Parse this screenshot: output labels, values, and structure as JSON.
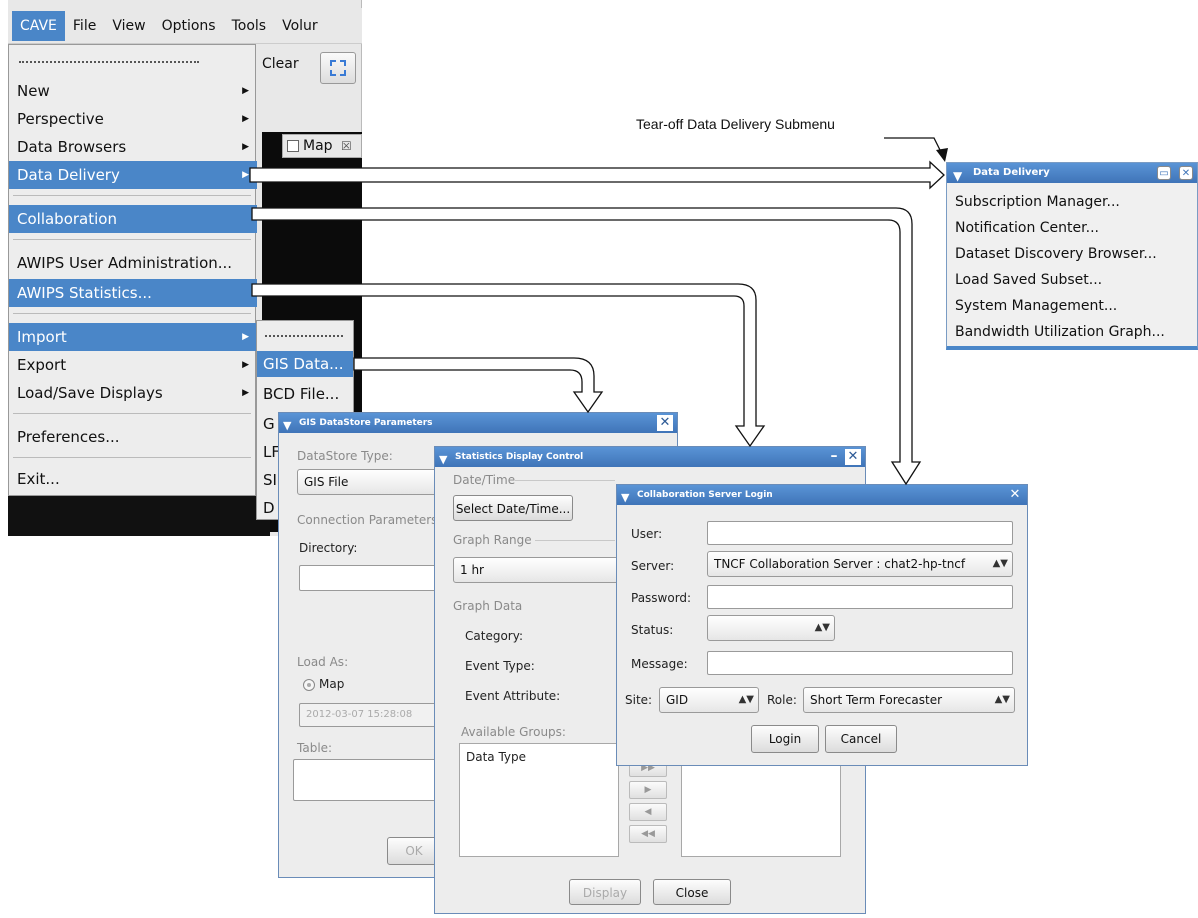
{
  "menubar": {
    "items": [
      "CAVE",
      "File",
      "View",
      "Options",
      "Tools",
      "Volur"
    ]
  },
  "toolbar": {
    "clear_label": "Clear"
  },
  "map_tab": {
    "label": "Map",
    "close": "☒"
  },
  "cave_menu": {
    "items": [
      {
        "label": "New"
      },
      {
        "label": "Perspective"
      },
      {
        "label": "Data Browsers"
      },
      {
        "label": "Data Delivery"
      },
      {
        "label": "Collaboration"
      },
      {
        "label": "AWIPS User Administration..."
      },
      {
        "label": "AWIPS Statistics..."
      },
      {
        "label": "Import"
      },
      {
        "label": "Export"
      },
      {
        "label": "Load/Save Displays"
      },
      {
        "label": "Preferences..."
      },
      {
        "label": "Exit..."
      }
    ]
  },
  "import_submenu": {
    "items": [
      "GIS Data...",
      "BCD File...",
      "G",
      "LF",
      "SI",
      "D"
    ]
  },
  "annotation": "Tear-off Data Delivery Submenu",
  "data_delivery": {
    "title": "Data Delivery",
    "items": [
      "Subscription Manager...",
      "Notification Center...",
      "Dataset Discovery Browser...",
      "Load Saved Subset...",
      "System Management...",
      "Bandwidth Utilization Graph..."
    ]
  },
  "gis_dialog": {
    "title": "GIS DataStore Parameters",
    "datastore_type_label": "DataStore Type:",
    "datastore_type_value": "GIS File",
    "connection_params_label": "Connection Parameters",
    "directory_label": "Directory:",
    "load_as_label": "Load As:",
    "map_radio_label": "Map",
    "date_value": "2012-03-07 15:28:08",
    "table_label": "Table:",
    "ok_label": "OK"
  },
  "stats_dialog": {
    "title": "Statistics Display Control",
    "date_time_group": "Date/Time",
    "select_date_label": "Select Date/Time...",
    "graph_range_group": "Graph Range",
    "graph_range_value": "1 hr",
    "graph_data_group": "Graph Data",
    "category_label": "Category:",
    "event_type_label": "Event Type:",
    "event_attribute_label": "Event Attribute:",
    "available_groups_label": "Available Groups:",
    "available_groups_items": [
      "Data Type"
    ],
    "display_label": "Display",
    "close_label": "Close"
  },
  "collab_dialog": {
    "title": "Collaboration Server Login",
    "user_label": "User:",
    "user_value": "",
    "server_label": "Server:",
    "server_value": "TNCF Collaboration Server : chat2-hp-tncf",
    "password_label": "Password:",
    "status_label": "Status:",
    "status_value": "",
    "message_label": "Message:",
    "message_value": "",
    "site_label": "Site:",
    "site_value": "GID",
    "role_label": "Role:",
    "role_value": "Short Term Forecaster",
    "login_label": "Login",
    "cancel_label": "Cancel"
  },
  "colors": {
    "highlight": "#4a86c8",
    "titlebar": "#3f74b8"
  }
}
